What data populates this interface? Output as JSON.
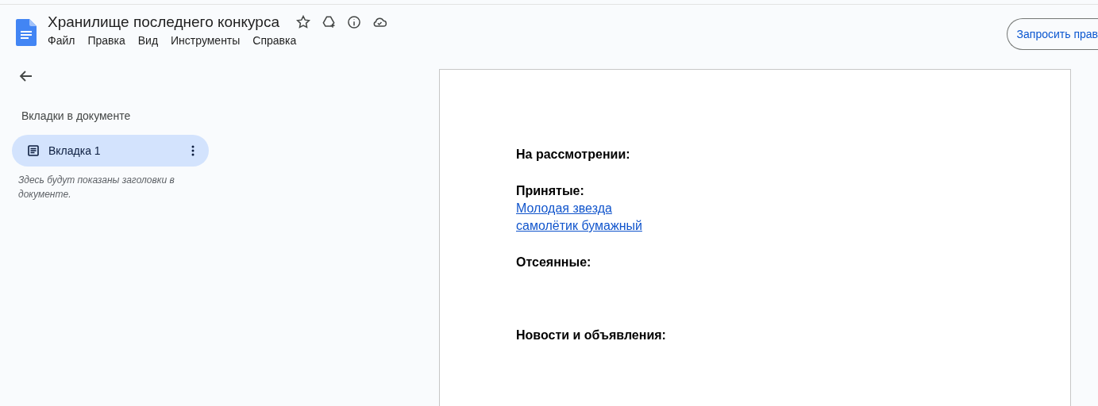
{
  "document": {
    "title": "Хранилище последнего конкурса"
  },
  "menu": [
    {
      "label": "Файл"
    },
    {
      "label": "Правка"
    },
    {
      "label": "Вид"
    },
    {
      "label": "Инструменты"
    },
    {
      "label": "Справка"
    }
  ],
  "share_button": {
    "label": "Запросить прав"
  },
  "sidebar": {
    "heading": "Вкладки в документе",
    "tabs": [
      {
        "label": "Вкладка 1",
        "selected": true
      }
    ],
    "hint": "Здесь будут показаны заголовки в документе."
  },
  "page": {
    "sections": [
      {
        "heading": "На рассмотрении:"
      },
      {
        "heading": "Принятые:",
        "links": [
          "Молодая звезда",
          "самолётик бумажный"
        ]
      },
      {
        "heading": "Отсеянные:"
      },
      {
        "heading": "Новости и объявления:"
      }
    ]
  }
}
